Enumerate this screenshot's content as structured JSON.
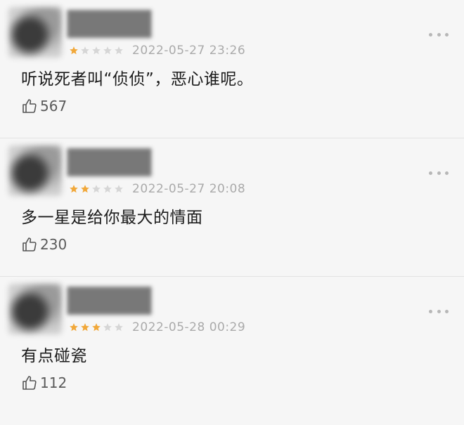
{
  "colors": {
    "star_filled": "#f1a83a",
    "star_empty": "#d6d6d6",
    "timestamp": "#aaaaaa",
    "background": "#f6f6f6"
  },
  "icons": {
    "rating": "star-icon",
    "like": "thumbs-up-icon",
    "more": "more-horizontal-icon"
  },
  "comments": [
    {
      "rating": 1,
      "max_rating": 5,
      "timestamp": "2022-05-27 23:26",
      "text": "听说死者叫“侦侦”，恶心谁呢。",
      "likes": "567"
    },
    {
      "rating": 2,
      "max_rating": 5,
      "timestamp": "2022-05-27 20:08",
      "text": "多一星是给你最大的情面",
      "likes": "230"
    },
    {
      "rating": 3,
      "max_rating": 5,
      "timestamp": "2022-05-28 00:29",
      "text": "有点碰瓷",
      "likes": "112"
    }
  ]
}
